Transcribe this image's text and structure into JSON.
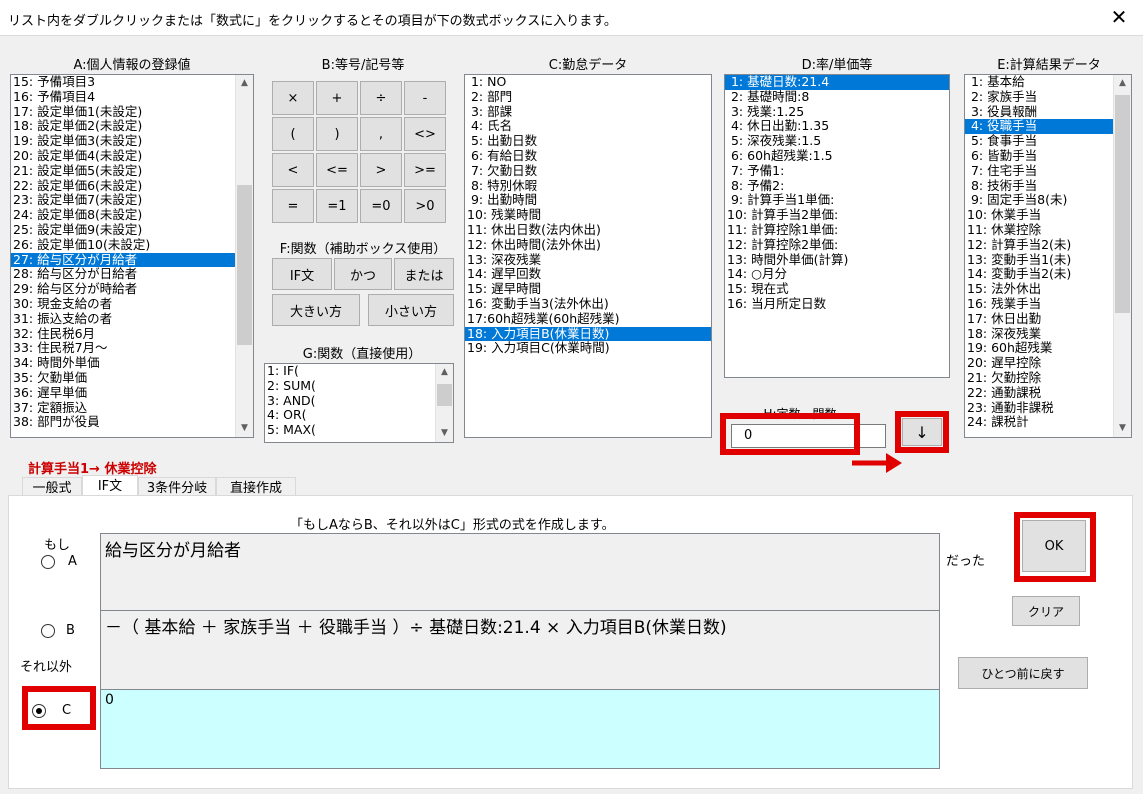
{
  "title": "リスト内をダブルクリックまたは「数式に」をクリックするとその項目が下の数式ボックスに入ります。",
  "close_glyph": "✕",
  "panel_a": {
    "header": "A:個人情報の登録値",
    "items": [
      {
        "label": "15: 予備項目3",
        "selected": false
      },
      {
        "label": "16: 予備項目4",
        "selected": false
      },
      {
        "label": "17: 設定単価1(未設定)",
        "selected": false
      },
      {
        "label": "18: 設定単価2(未設定)",
        "selected": false
      },
      {
        "label": "19: 設定単価3(未設定)",
        "selected": false
      },
      {
        "label": "20: 設定単価4(未設定)",
        "selected": false
      },
      {
        "label": "21: 設定単価5(未設定)",
        "selected": false
      },
      {
        "label": "22: 設定単価6(未設定)",
        "selected": false
      },
      {
        "label": "23: 設定単価7(未設定)",
        "selected": false
      },
      {
        "label": "24: 設定単価8(未設定)",
        "selected": false
      },
      {
        "label": "25: 設定単価9(未設定)",
        "selected": false
      },
      {
        "label": "26: 設定単価10(未設定)",
        "selected": false
      },
      {
        "label": "27: 給与区分が月給者",
        "selected": true
      },
      {
        "label": "28: 給与区分が日給者",
        "selected": false
      },
      {
        "label": "29: 給与区分が時給者",
        "selected": false
      },
      {
        "label": "30: 現金支給の者",
        "selected": false
      },
      {
        "label": "31: 振込支給の者",
        "selected": false
      },
      {
        "label": "32: 住民税6月",
        "selected": false
      },
      {
        "label": "33: 住民税7月～",
        "selected": false
      },
      {
        "label": "34: 時間外単価",
        "selected": false
      },
      {
        "label": "35: 欠勤単価",
        "selected": false
      },
      {
        "label": "36: 遅早単価",
        "selected": false
      },
      {
        "label": "37: 定額振込",
        "selected": false
      },
      {
        "label": "38: 部門が役員",
        "selected": false
      }
    ]
  },
  "panel_b": {
    "header": "B:等号/記号等",
    "buttons": [
      "×",
      "+",
      "÷",
      "-",
      "(",
      ")",
      ",",
      "<>",
      "<",
      "<=",
      ">",
      ">=",
      "=",
      "=1",
      "=0",
      ">0"
    ]
  },
  "panel_f": {
    "header": "F:関数（補助ボックス使用）",
    "buttons": [
      "IF文",
      "かつ",
      "または",
      "大きい方",
      "小さい方"
    ]
  },
  "panel_g": {
    "header": "G:関数（直接使用）",
    "items": [
      "1: IF(",
      "2: SUM(",
      "3: AND(",
      "4: OR(",
      "5: MAX("
    ]
  },
  "panel_c": {
    "header": "C:勤怠データ",
    "items": [
      {
        "label": " 1: NO",
        "selected": false
      },
      {
        "label": " 2: 部門",
        "selected": false
      },
      {
        "label": " 3: 部課",
        "selected": false
      },
      {
        "label": " 4: 氏名",
        "selected": false
      },
      {
        "label": " 5: 出勤日数",
        "selected": false
      },
      {
        "label": " 6: 有給日数",
        "selected": false
      },
      {
        "label": " 7: 欠勤日数",
        "selected": false
      },
      {
        "label": " 8: 特別休暇",
        "selected": false
      },
      {
        "label": " 9: 出勤時間",
        "selected": false
      },
      {
        "label": "10: 残業時間",
        "selected": false
      },
      {
        "label": "11: 休出日数(法内休出)",
        "selected": false
      },
      {
        "label": "12: 休出時間(法外休出)",
        "selected": false
      },
      {
        "label": "13: 深夜残業",
        "selected": false
      },
      {
        "label": "14: 遅早回数",
        "selected": false
      },
      {
        "label": "15: 遅早時間",
        "selected": false
      },
      {
        "label": "16: 変動手当3(法外休出)",
        "selected": false
      },
      {
        "label": "17:60h超残業(60h超残業)",
        "selected": false
      },
      {
        "label": "18: 入力項目B(休業日数)",
        "selected": true
      },
      {
        "label": "19: 入力項目C(休業時間)",
        "selected": false
      }
    ]
  },
  "panel_d": {
    "header": "D:率/単価等",
    "items": [
      {
        "label": " 1: 基礎日数:21.4",
        "selected": true
      },
      {
        "label": " 2: 基礎時間:8",
        "selected": false
      },
      {
        "label": " 3: 残業:1.25",
        "selected": false
      },
      {
        "label": " 4: 休日出勤:1.35",
        "selected": false
      },
      {
        "label": " 5: 深夜残業:1.5",
        "selected": false
      },
      {
        "label": " 6: 60h超残業:1.5",
        "selected": false
      },
      {
        "label": " 7: 予備1:",
        "selected": false
      },
      {
        "label": " 8: 予備2:",
        "selected": false
      },
      {
        "label": " 9: 計算手当1単価:",
        "selected": false
      },
      {
        "label": "10: 計算手当2単価:",
        "selected": false
      },
      {
        "label": "11: 計算控除1単価:",
        "selected": false
      },
      {
        "label": "12: 計算控除2単価:",
        "selected": false
      },
      {
        "label": "13: 時間外単価(計算)",
        "selected": false
      },
      {
        "label": "14: ○月分",
        "selected": false
      },
      {
        "label": "15: 現在式",
        "selected": false
      },
      {
        "label": "16: 当月所定日数",
        "selected": false
      }
    ]
  },
  "panel_h": {
    "header": "H:定数、関数",
    "value": "0",
    "insert_glyph": "↓"
  },
  "panel_e": {
    "header": "E:計算結果データ",
    "items": [
      {
        "label": " 1: 基本給",
        "selected": false
      },
      {
        "label": " 2: 家族手当",
        "selected": false
      },
      {
        "label": " 3: 役員報酬",
        "selected": false
      },
      {
        "label": " 4: 役職手当",
        "selected": true
      },
      {
        "label": " 5: 食事手当",
        "selected": false
      },
      {
        "label": " 6: 皆勤手当",
        "selected": false
      },
      {
        "label": " 7: 住宅手当",
        "selected": false
      },
      {
        "label": " 8: 技術手当",
        "selected": false
      },
      {
        "label": " 9: 固定手当8(未)",
        "selected": false
      },
      {
        "label": "10: 休業手当",
        "selected": false
      },
      {
        "label": "11: 休業控除",
        "selected": false
      },
      {
        "label": "12: 計算手当2(未)",
        "selected": false
      },
      {
        "label": "13: 変動手当1(未)",
        "selected": false
      },
      {
        "label": "14: 変動手当2(未)",
        "selected": false
      },
      {
        "label": "15: 法外休出",
        "selected": false
      },
      {
        "label": "16: 残業手当",
        "selected": false
      },
      {
        "label": "17: 休日出勤",
        "selected": false
      },
      {
        "label": "18: 深夜残業",
        "selected": false
      },
      {
        "label": "19: 60h超残業",
        "selected": false
      },
      {
        "label": "20: 遅早控除",
        "selected": false
      },
      {
        "label": "21: 欠勤控除",
        "selected": false
      },
      {
        "label": "22: 通勤課税",
        "selected": false
      },
      {
        "label": "23: 通勤非課税",
        "selected": false
      },
      {
        "label": "24: 課税計",
        "selected": false
      }
    ]
  },
  "target_label": "計算手当1→ 休業控除",
  "tabs": [
    "一般式",
    "IF文",
    "3条件分岐",
    "直接作成"
  ],
  "active_tab": 1,
  "if_panel": {
    "description": "「もしAならB、それ以外はC」形式の式を作成します。",
    "moshi_label": "もし",
    "datta_label": "だった",
    "sore_igai_label": "それ以外",
    "radio_a": "A",
    "radio_b": "B",
    "radio_c": "C",
    "selected_radio": "C",
    "formula_a": "給与区分が月給者",
    "formula_b": "－（ 基本給 ＋ 家族手当 ＋ 役職手当 ）÷ 基礎日数:21.4 × 入力項目B(休業日数)",
    "formula_c": "0",
    "ok_label": "OK",
    "clear_label": "クリア",
    "undo_label": "ひとつ前に戻す"
  },
  "colors": {
    "selection": "#0078d7",
    "highlight_red": "#e00000",
    "target_red": "#cc0000",
    "formula_c_bg": "#ccffff"
  }
}
